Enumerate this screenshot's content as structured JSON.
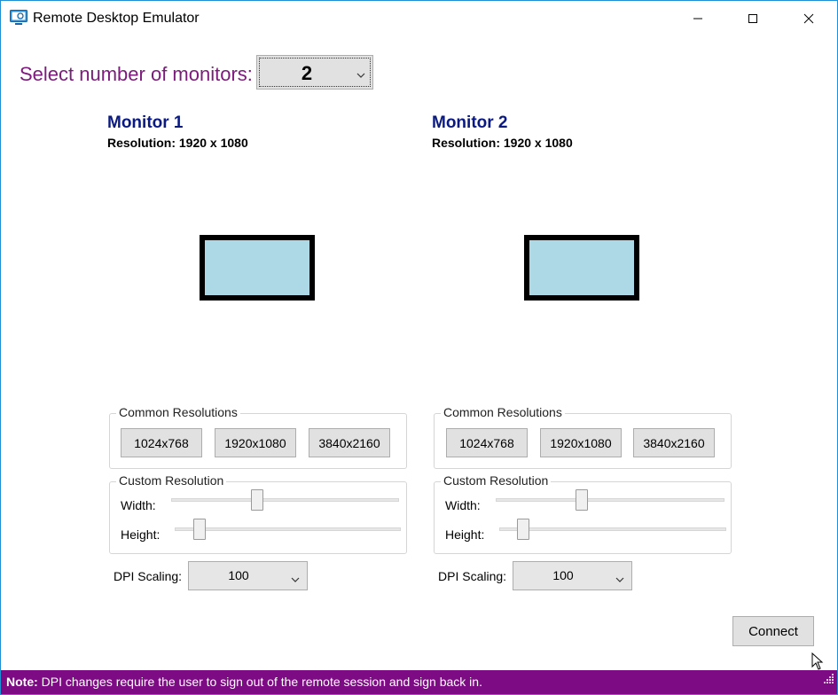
{
  "window": {
    "title": "Remote Desktop Emulator",
    "icon": "remote-desktop-icon"
  },
  "selector": {
    "label": "Select number of monitors:",
    "value": "2"
  },
  "monitors": [
    {
      "title": "Monitor 1",
      "resolution": "Resolution: 1920 x 1080",
      "common_legend": "Common Resolutions",
      "presets": [
        "1024x768",
        "1920x1080",
        "3840x2160"
      ],
      "custom_legend": "Custom Resolution",
      "width_label": "Width:",
      "height_label": "Height:",
      "dpi_label": "DPI Scaling:",
      "dpi_value": "100"
    },
    {
      "title": "Monitor 2",
      "resolution": "Resolution: 1920 x 1080",
      "common_legend": "Common Resolutions",
      "presets": [
        "1024x768",
        "1920x1080",
        "3840x2160"
      ],
      "custom_legend": "Custom Resolution",
      "width_label": "Width:",
      "height_label": "Height:",
      "dpi_label": "DPI Scaling:",
      "dpi_value": "100"
    }
  ],
  "connect_label": "Connect",
  "status": {
    "prefix": "Note:",
    "message": " DPI changes require the user to sign out of the remote session and sign back in."
  },
  "colors": {
    "accent": "#7d0b83",
    "monitor_title": "#0a1a80",
    "monitor_fill": "#add8e6",
    "selector_label": "#7b1c7b"
  }
}
